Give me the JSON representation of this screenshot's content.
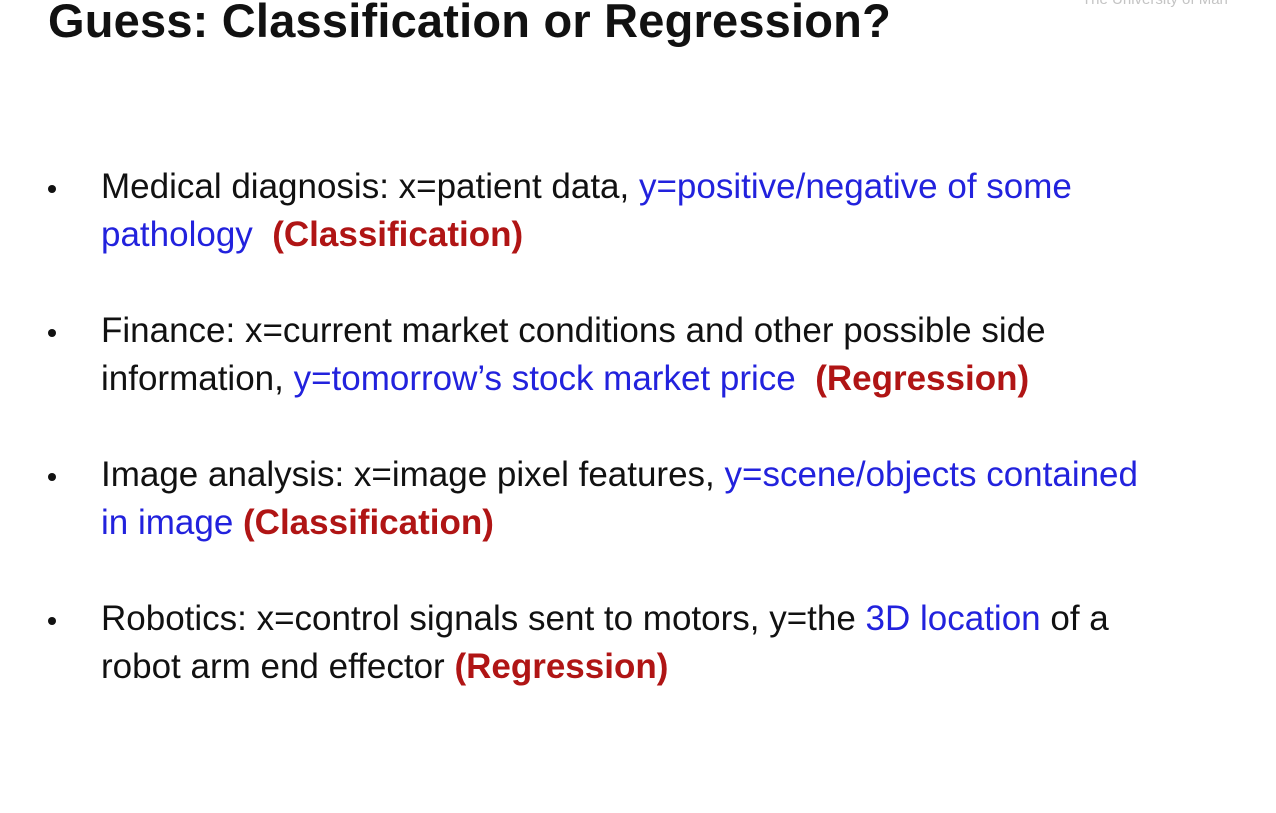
{
  "slide": {
    "title": "Guess: Classification or Regression?",
    "watermark": "The University of Man",
    "bullets": [
      {
        "line1_plain": "Medical diagnosis: x=patient data, ",
        "line1_blue": "y=positive/negative of some",
        "line2_blue": "pathology",
        "line2_red": "(Classification)"
      },
      {
        "line1_plain": "Finance: x=current market conditions and other possible side",
        "line2_plain": "information, ",
        "line2_blue": "y=tomorrow’s stock market price",
        "line2_red": "(Regression)"
      },
      {
        "line1_plain": "Image analysis: x=image pixel features, ",
        "line1_blue": "y=scene/objects contained",
        "line2_blue": "in image",
        "line2_red": "(Classification)"
      },
      {
        "line1_plain": "Robotics: x=control signals sent to motors, y=the ",
        "line1_blue": "3D location",
        "line1_plain_after": " of a",
        "line2_plain": "robot arm end effector ",
        "line2_red": "(Regression)"
      }
    ]
  },
  "colors": {
    "highlight_blue": "#2222dd",
    "answer_red": "#b01515",
    "text": "#111111"
  }
}
